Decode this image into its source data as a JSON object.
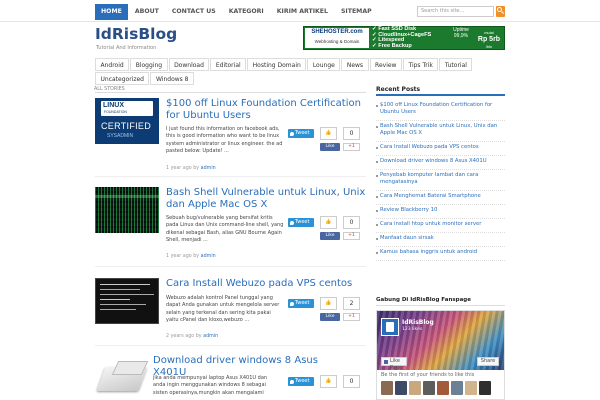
{
  "nav": {
    "items": [
      "HOME",
      "ABOUT",
      "CONTACT US",
      "KATEGORI",
      "KIRIM ARTIKEL",
      "SITEMAP"
    ],
    "search_placeholder": "Search this site..."
  },
  "header": {
    "logo": "IdRisBlog",
    "tagline": "Tutorial And Information"
  },
  "banner": {
    "brand": "SHEHOSTER.com",
    "brand_sub": "Webhosting & Domain",
    "features": [
      "✓ Fast SSD Disk",
      "✓ Cloudlinux+CageFS",
      "✓ Litespeed",
      "✓ Free Backup"
    ],
    "uptime": "Uptime 99,9%",
    "price_prefix": "mulai",
    "price": "Rp 5rb",
    "price_suffix": "/bln"
  },
  "categories": [
    "Android",
    "Blogging",
    "Download",
    "Editorial",
    "Hosting Domain",
    "Lounge",
    "News",
    "Review",
    "Tips Trik",
    "Tutorial",
    "Uncategorized",
    "Windows 8"
  ],
  "main": {
    "section_label": "ALL STORIES",
    "posts": [
      {
        "title": "$100 off Linux Foundation Certification for Ubuntu Users",
        "excerpt": "I just found this information on facebook ads, this is good information who want to be linux system administrator or  linux engineer. the ad pasted below:    Update! ...",
        "meta_time": "1 year ago by",
        "author": "admin",
        "likes": "0",
        "thumb_text": [
          "LINUX",
          "FOUNDATION",
          "CERTIFIED",
          "SYSADMIN"
        ]
      },
      {
        "title": "Bash Shell Vulnerable untuk Linux, Unix dan Apple Mac OS X",
        "excerpt": "Sebuah bug/vulnerable yang bersifat kritis pada Linux dan Unix command-line shell, yang dikenal sebagai Bash, alias GNU Bourne Again Shell,  menjadi ...",
        "meta_time": "1 year ago by",
        "author": "admin",
        "likes": "0"
      },
      {
        "title": "Cara Install Webuzo pada VPS centos",
        "excerpt": "Webuzo adalah kontrol Panel  tunggal yang dapat Anda gunakan untuk mengelola server selain yang terkenal dan sering kita pakai yaitu cPanel dan kloxo,webuzo ...",
        "meta_time": "2 years ago by",
        "author": "admin",
        "likes": "2"
      },
      {
        "title": "Download driver windows 8 Asus X401U",
        "excerpt": "jika anda mempunyai laptop Asus X401U dan anda ingin menggunakan windows 8 sebagai sisten operasinya,mungkin akan mengalami",
        "meta_time": "",
        "author": "",
        "likes": "0"
      }
    ],
    "share": {
      "tweet": "Tweet",
      "fb_like": "Like",
      "gplus": "+1"
    }
  },
  "sidebar": {
    "recent_title": "Recent Posts",
    "recent": [
      "$100 off Linux Foundation Certification for Ubuntu Users",
      "Bash Shell Vulnerable untuk Linux, Unix dan Apple Mac OS X",
      "Cara Install Webuzo pada VPS centos",
      "Download driver windows 8 Asus X401U",
      "Penyebab komputer lambat dan cara mengatasinya",
      "Cara Menghemat Baterai Smartphone",
      "Review Blackberry 10",
      "Cara install htop untuk monitor server",
      "Manfaat daun sirsak",
      "Kamus bahasa inggris untuk android"
    ],
    "fb_title": "Gabung Di IdRisBlog Fanspage",
    "fb_page": "IdRisBlog",
    "fb_likes": "123 likes",
    "fb_like_btn": "Like Page",
    "fb_share_btn": "Share",
    "fb_friends": "Be the first of your friends to like this"
  }
}
